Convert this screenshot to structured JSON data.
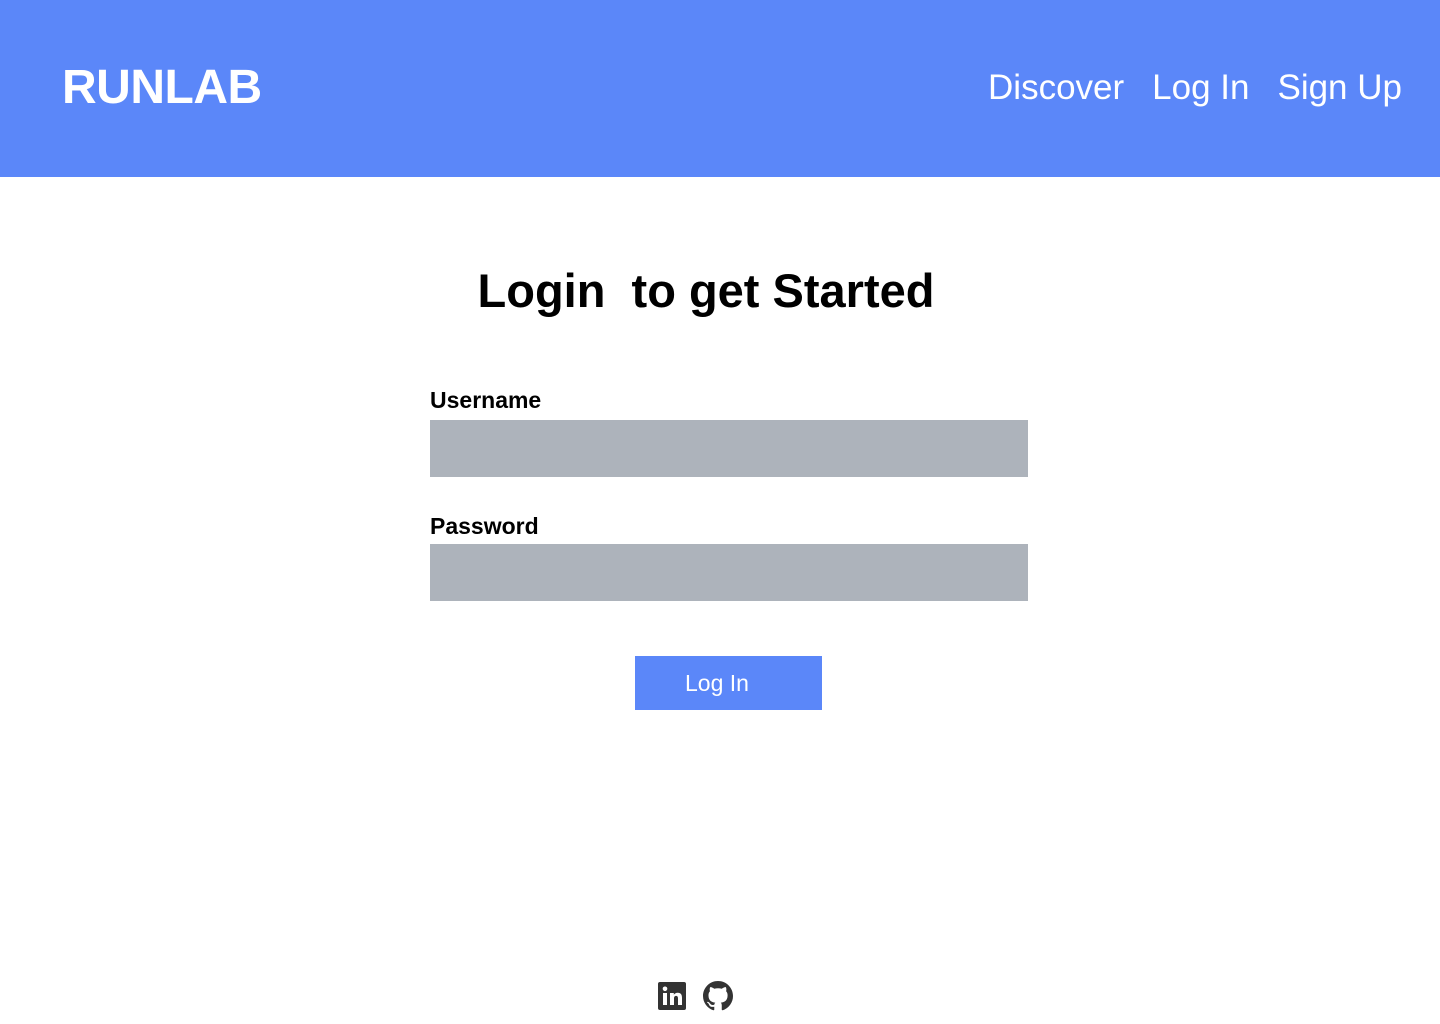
{
  "header": {
    "logo_text": "RUNLAB",
    "nav": [
      {
        "label": "Discover"
      },
      {
        "label": "Log In"
      },
      {
        "label": "Sign Up"
      }
    ]
  },
  "main": {
    "heading": "Login  to get Started",
    "username": {
      "label": "Username",
      "value": "",
      "placeholder": ""
    },
    "password": {
      "label": "Password",
      "value": "",
      "placeholder": ""
    },
    "submit_label": "Log In"
  },
  "footer": {
    "icons": [
      "linkedin-icon",
      "github-icon"
    ]
  },
  "colors": {
    "brand": "#5b87f9",
    "input_bg": "#adb3bb",
    "text": "#000000",
    "icon": "#333333"
  }
}
